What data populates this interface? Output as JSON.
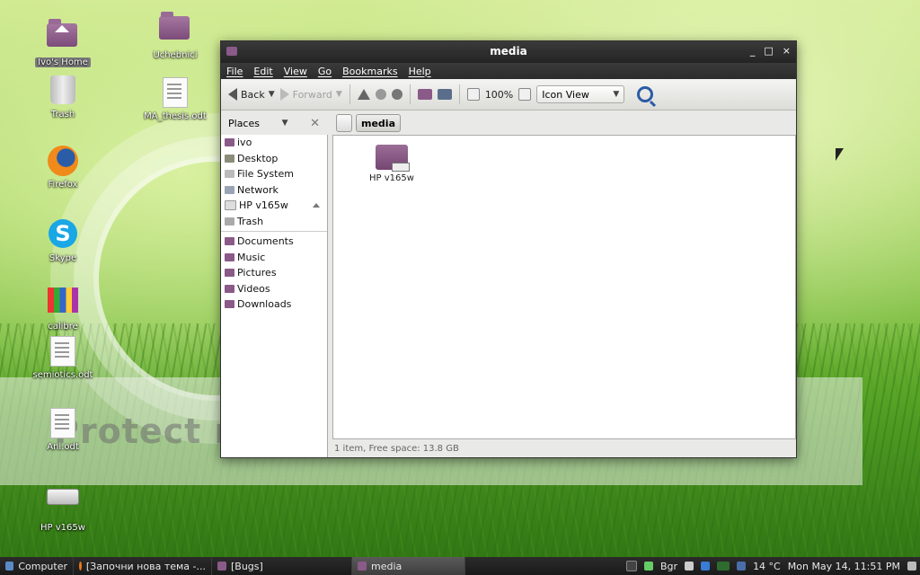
{
  "desktop": {
    "icons": [
      {
        "label": "Ivo's Home"
      },
      {
        "label": "Uchebnici"
      },
      {
        "label": "Trash"
      },
      {
        "label": "MA_thesis.odt"
      },
      {
        "label": "Firefox"
      },
      {
        "label": "Skype"
      },
      {
        "label": "calibre"
      },
      {
        "label": "semiotics.odt"
      },
      {
        "label": "Ani.odt"
      },
      {
        "label": "HP v165w"
      }
    ],
    "banner_text": "Protect m... your memories for less!"
  },
  "window": {
    "title": "media",
    "controls": {
      "minimize": "_",
      "maximize": "□",
      "close": "×"
    },
    "menu": [
      "File",
      "Edit",
      "View",
      "Go",
      "Bookmarks",
      "Help"
    ],
    "toolbar": {
      "back": "Back",
      "forward": "Forward",
      "zoom": "100%",
      "view_mode": "Icon View"
    },
    "places_label": "Places",
    "path": {
      "current": "media"
    },
    "sidebar": {
      "group1": [
        "ivo",
        "Desktop",
        "File System",
        "Network",
        "HP v165w",
        "Trash"
      ],
      "group2": [
        "Documents",
        "Music",
        "Pictures",
        "Videos",
        "Downloads"
      ]
    },
    "files": [
      {
        "label": "HP v165w"
      }
    ],
    "status": "1 item, Free space: 13.8 GB"
  },
  "taskbar": {
    "start": "Computer",
    "tasks": [
      "[Започни нова тема -...",
      "[Bugs]",
      "media"
    ],
    "keyboard": "Bgr",
    "weather": "14 °C",
    "clock": "Mon May 14, 11:51 PM"
  },
  "colors": {
    "accent": "#8a5a88",
    "titlebar": "#2b2b2b",
    "search": "#2b5ba8"
  }
}
